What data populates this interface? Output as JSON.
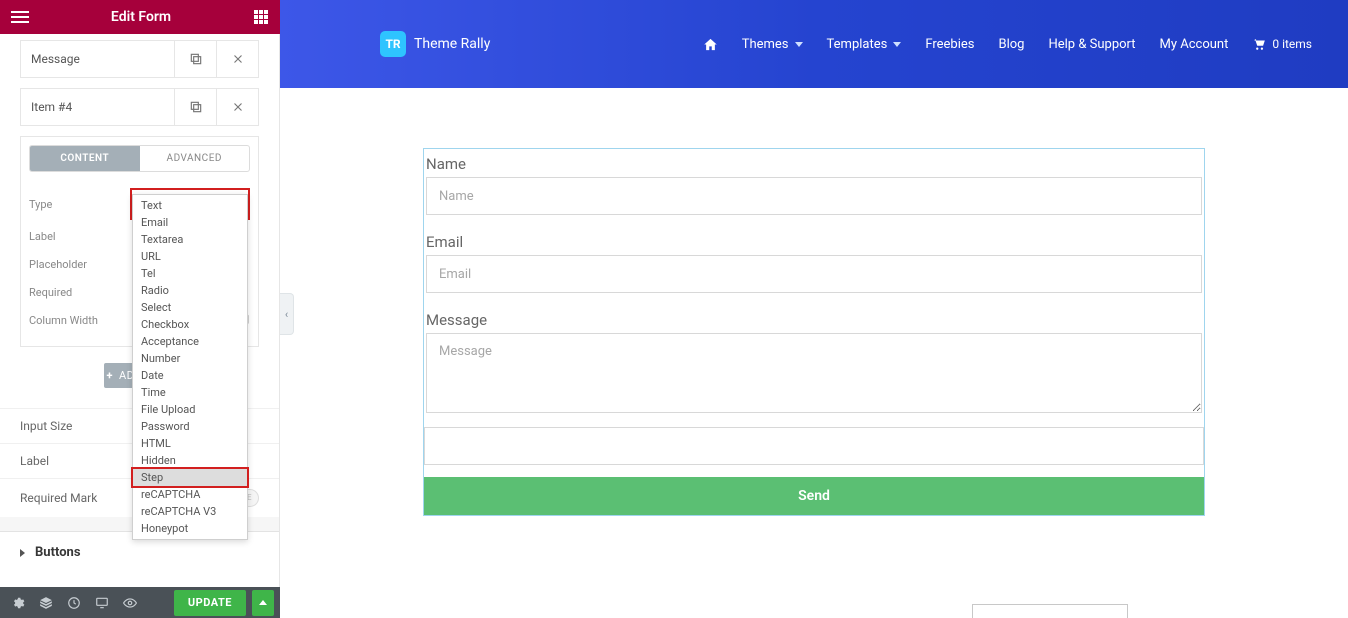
{
  "editor": {
    "title": "Edit Form",
    "fields": [
      {
        "label": "Message"
      },
      {
        "label": "Item #4"
      }
    ],
    "tabs": {
      "content": "CONTENT",
      "advanced": "ADVANCED"
    },
    "controls": {
      "type_label": "Type",
      "type_value": "Text",
      "label_label": "Label",
      "placeholder_label": "Placeholder",
      "required_label": "Required",
      "colwidth_label": "Column Width"
    },
    "type_options": [
      "Text",
      "Email",
      "Textarea",
      "URL",
      "Tel",
      "Radio",
      "Select",
      "Checkbox",
      "Acceptance",
      "Number",
      "Date",
      "Time",
      "File Upload",
      "Password",
      "HTML",
      "Hidden",
      "Step",
      "reCAPTCHA",
      "reCAPTCHA V3",
      "Honeypot"
    ],
    "type_selected": "Step",
    "add_button": "ADD ITEM",
    "lower": {
      "input_size": "Input Size",
      "label": "Label",
      "required_mark": "Required Mark",
      "required_mark_state": "HIDE"
    },
    "accordion_buttons": "Buttons",
    "update": "UPDATE"
  },
  "site": {
    "brand_text": "Theme Rally",
    "brand_logo": "TR",
    "nav": {
      "themes": "Themes",
      "templates": "Templates",
      "freebies": "Freebies",
      "blog": "Blog",
      "help": "Help & Support",
      "account": "My Account",
      "cart": "0 items"
    }
  },
  "form": {
    "name_label": "Name",
    "name_placeholder": "Name",
    "email_label": "Email",
    "email_placeholder": "Email",
    "message_label": "Message",
    "message_placeholder": "Message",
    "send": "Send"
  }
}
